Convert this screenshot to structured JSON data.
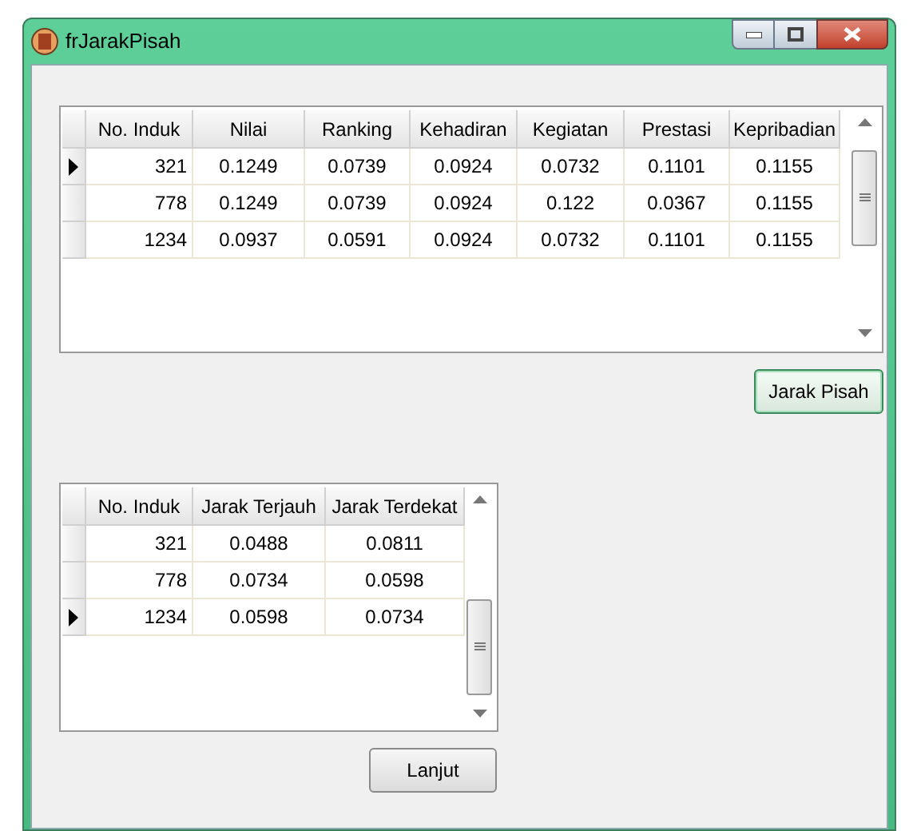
{
  "window": {
    "title": "frJarakPisah"
  },
  "grid_1": {
    "columns": [
      "No. Induk",
      "Nilai",
      "Ranking",
      "Kehadiran",
      "Kegiatan",
      "Prestasi",
      "Kepribadian"
    ],
    "rows": [
      {
        "selected": true,
        "cells": [
          "321",
          "0.1249",
          "0.0739",
          "0.0924",
          "0.0732",
          "0.1101",
          "0.1155"
        ]
      },
      {
        "selected": false,
        "cells": [
          "778",
          "0.1249",
          "0.0739",
          "0.0924",
          "0.122",
          "0.0367",
          "0.1155"
        ]
      },
      {
        "selected": false,
        "cells": [
          "1234",
          "0.0937",
          "0.0591",
          "0.0924",
          "0.0732",
          "0.1101",
          "0.1155"
        ]
      }
    ]
  },
  "button_1": "Jarak Pisah",
  "grid_2": {
    "columns": [
      "No. Induk",
      "Jarak Terjauh",
      "Jarak Terdekat"
    ],
    "rows": [
      {
        "selected": false,
        "cells": [
          "321",
          "0.0488",
          "0.0811"
        ]
      },
      {
        "selected": false,
        "cells": [
          "778",
          "0.0734",
          "0.0598"
        ]
      },
      {
        "selected": true,
        "cells": [
          "1234",
          "0.0598",
          "0.0734"
        ]
      }
    ]
  },
  "button_2": "Lanjut"
}
